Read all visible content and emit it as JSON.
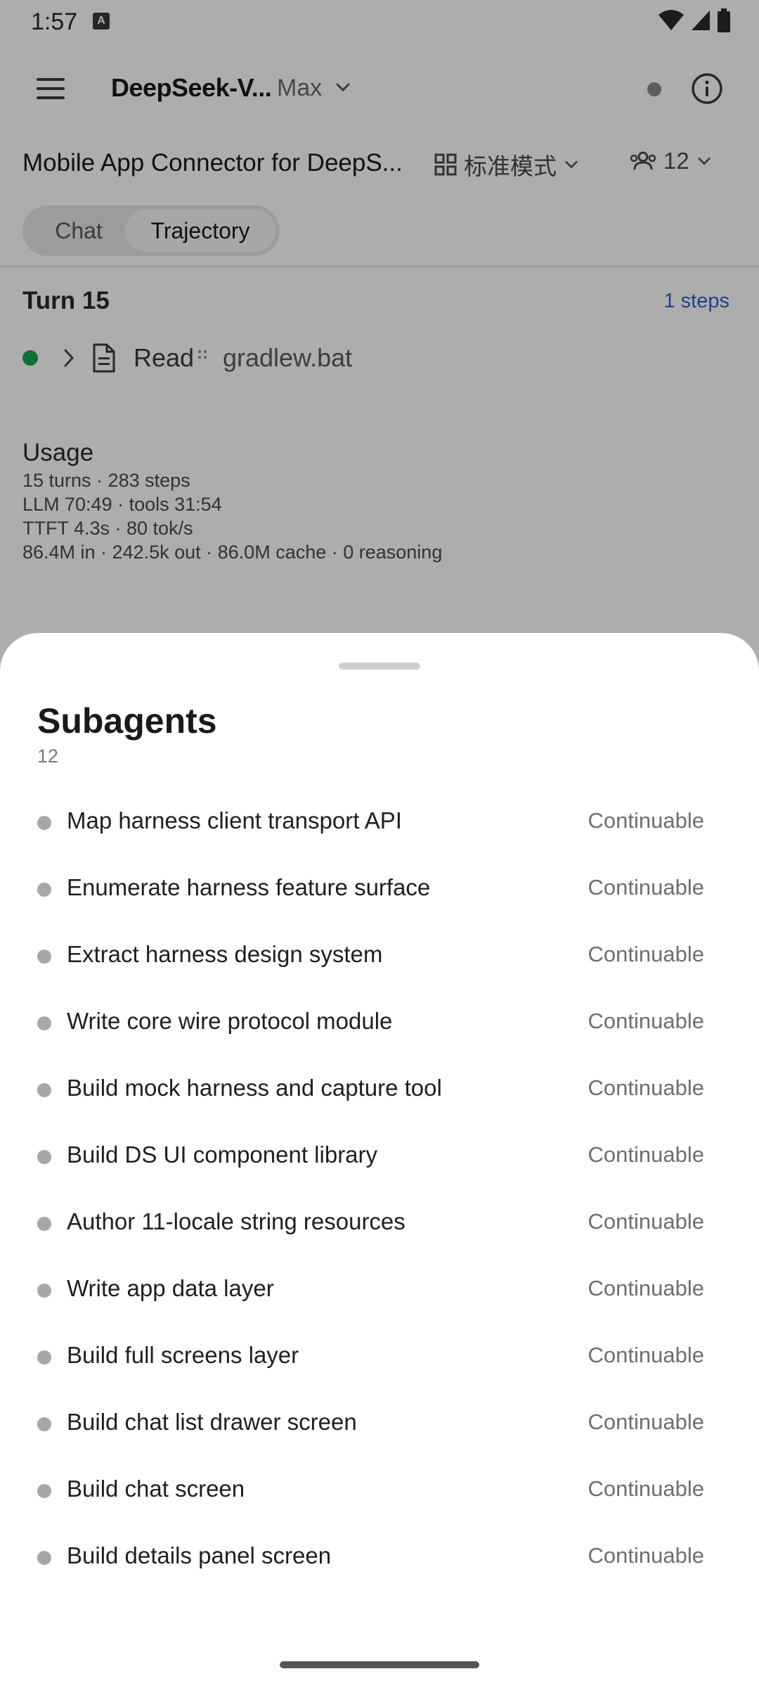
{
  "status_bar": {
    "time": "1:57",
    "notif_badge": "A"
  },
  "header": {
    "model_name": "DeepSeek-V...",
    "model_tier": "Max"
  },
  "project": {
    "title": "Mobile App Connector for DeepS...",
    "mode_label": "标准模式",
    "agent_count": "12"
  },
  "tabs": [
    {
      "label": "Chat"
    },
    {
      "label": "Trajectory"
    }
  ],
  "turn": {
    "title": "Turn 15",
    "steps_label": "1 steps",
    "step": {
      "tool": "Read",
      "target": "gradlew.bat"
    }
  },
  "usage": {
    "title": "Usage",
    "lines": [
      "15 turns · 283 steps",
      "LLM 70:49 · tools 31:54",
      "TTFT 4.3s · 80 tok/s",
      "86.4M in · 242.5k out · 86.0M cache · 0 reasoning"
    ]
  },
  "subagents": {
    "title": "Subagents",
    "count": "12",
    "items": [
      {
        "name": "Map harness client transport API",
        "status": "Continuable"
      },
      {
        "name": "Enumerate harness feature surface",
        "status": "Continuable"
      },
      {
        "name": "Extract harness design system",
        "status": "Continuable"
      },
      {
        "name": "Write core wire protocol module",
        "status": "Continuable"
      },
      {
        "name": "Build mock harness and capture tool",
        "status": "Continuable"
      },
      {
        "name": "Build DS UI component library",
        "status": "Continuable"
      },
      {
        "name": "Author 11-locale string resources",
        "status": "Continuable"
      },
      {
        "name": "Write app data layer",
        "status": "Continuable"
      },
      {
        "name": "Build full screens layer",
        "status": "Continuable"
      },
      {
        "name": "Build chat list drawer screen",
        "status": "Continuable"
      },
      {
        "name": "Build chat screen",
        "status": "Continuable"
      },
      {
        "name": "Build details panel screen",
        "status": "Continuable"
      }
    ]
  },
  "colors": {
    "accent_link": "#2f5fd0",
    "active_dot": "#1aa64a",
    "scrim": "rgba(0,0,0,0.32)"
  }
}
